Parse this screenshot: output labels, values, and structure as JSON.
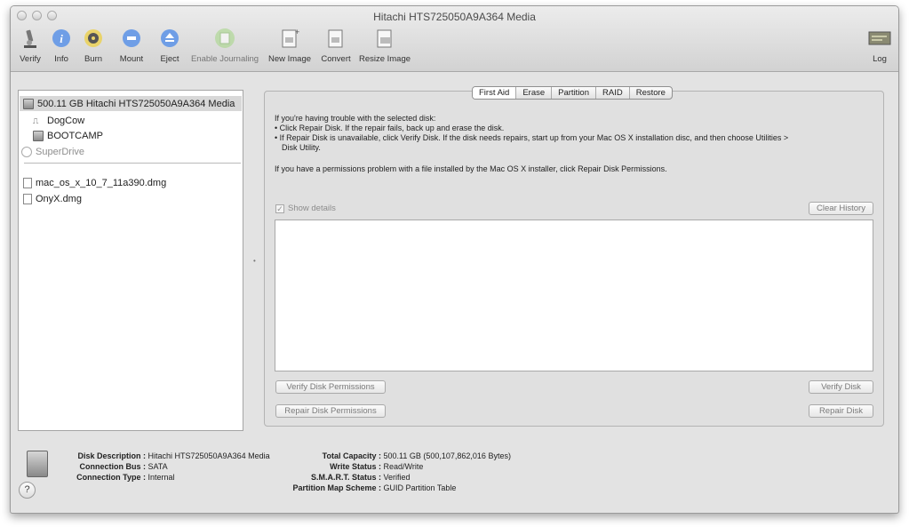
{
  "window": {
    "title": "Hitachi HTS725050A9A364 Media"
  },
  "toolbar": {
    "items": [
      {
        "label": "Verify",
        "icon": "microscope-icon"
      },
      {
        "label": "Info",
        "icon": "info-icon"
      },
      {
        "label": "Burn",
        "icon": "burn-icon"
      },
      {
        "label": "Mount",
        "icon": "mount-icon"
      },
      {
        "label": "Eject",
        "icon": "eject-icon"
      },
      {
        "label": "Enable Journaling",
        "icon": "journaling-icon"
      },
      {
        "label": "New Image",
        "icon": "new-image-icon"
      },
      {
        "label": "Convert",
        "icon": "convert-icon"
      },
      {
        "label": "Resize Image",
        "icon": "resize-image-icon"
      },
      {
        "label": "Log",
        "icon": "log-icon"
      }
    ]
  },
  "sidebar": {
    "items": [
      {
        "label": "500.11 GB Hitachi HTS725050A9A364 Media",
        "icon": "disk-icon",
        "selected": true
      },
      {
        "label": "DogCow",
        "icon": "volume-icon"
      },
      {
        "label": "BOOTCAMP",
        "icon": "volume-icon"
      },
      {
        "label": "SuperDrive",
        "icon": "optical-drive-icon"
      },
      {
        "label": "mac_os_x_10_7_11a390.dmg",
        "icon": "dmg-file-icon"
      },
      {
        "label": "OnyX.dmg",
        "icon": "dmg-file-icon"
      }
    ]
  },
  "tabs": [
    "First Aid",
    "Erase",
    "Partition",
    "RAID",
    "Restore"
  ],
  "first_aid": {
    "intro": "If you're having trouble with the selected disk:",
    "bullet1": "• Click Repair Disk. If the repair fails, back up and erase the disk.",
    "bullet2_line1": "• If Repair Disk is unavailable, click Verify Disk. If the disk needs repairs, start up from your Mac OS X installation disc, and then choose Utilities >",
    "bullet2_line2": "Disk Utility.",
    "permissions": "If you have a permissions problem with a file installed by the Mac OS X installer, click Repair Disk Permissions.",
    "show_details": "Show details",
    "show_details_checked": true,
    "clear_history": "Clear History",
    "verify_permissions": "Verify Disk Permissions",
    "verify_disk": "Verify Disk",
    "repair_permissions": "Repair Disk Permissions",
    "repair_disk": "Repair Disk"
  },
  "disk_info": {
    "description_label": "Disk Description :",
    "description": "Hitachi HTS725050A9A364 Media",
    "bus_label": "Connection Bus :",
    "bus": "SATA",
    "type_label": "Connection Type :",
    "type": "Internal",
    "capacity_label": "Total Capacity :",
    "capacity": "500.11 GB (500,107,862,016 Bytes)",
    "write_label": "Write Status :",
    "write": "Read/Write",
    "smart_label": "S.M.A.R.T. Status :",
    "smart": "Verified",
    "map_label": "Partition Map Scheme :",
    "map": "GUID Partition Table"
  },
  "help": {
    "label": "?"
  }
}
